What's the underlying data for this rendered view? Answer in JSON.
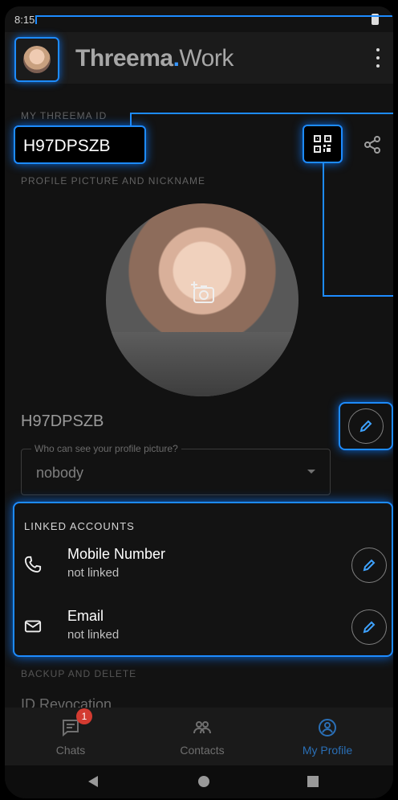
{
  "status_bar": {
    "time": "8:15"
  },
  "app_bar": {
    "brand_main": "Threema",
    "brand_dot": ".",
    "brand_suffix": "Work"
  },
  "id_section": {
    "label": "MY THREEMA ID",
    "id_value": "H97DPSZB"
  },
  "profile_section": {
    "label": "PROFILE PICTURE AND NICKNAME",
    "nickname": "H97DPSZB",
    "visibility_label": "Who can see your profile picture?",
    "visibility_value": "nobody"
  },
  "linked_accounts": {
    "title": "LINKED ACCOUNTS",
    "items": [
      {
        "title": "Mobile Number",
        "status": "not linked"
      },
      {
        "title": "Email",
        "status": "not linked"
      }
    ]
  },
  "backup_section": {
    "label": "BACKUP AND DELETE",
    "peek": "ID Revocation"
  },
  "bottom_nav": {
    "items": [
      {
        "label": "Chats",
        "badge": "1"
      },
      {
        "label": "Contacts"
      },
      {
        "label": "My Profile"
      }
    ]
  },
  "colors": {
    "accent": "#1d8bff",
    "background": "#121212",
    "badge": "#d33b31"
  }
}
